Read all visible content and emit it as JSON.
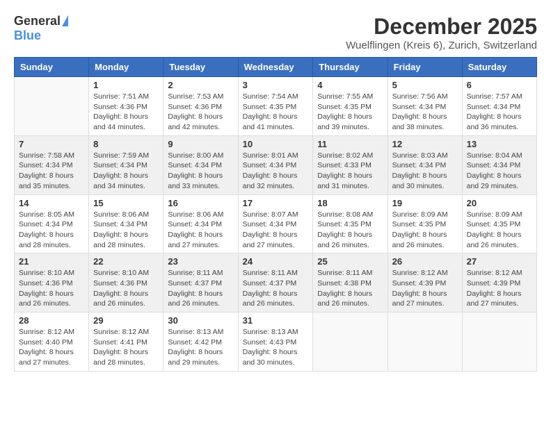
{
  "header": {
    "logo_general": "General",
    "logo_blue": "Blue",
    "title": "December 2025",
    "subtitle": "Wuelflingen (Kreis 6), Zurich, Switzerland"
  },
  "columns": [
    "Sunday",
    "Monday",
    "Tuesday",
    "Wednesday",
    "Thursday",
    "Friday",
    "Saturday"
  ],
  "weeks": [
    {
      "shaded": false,
      "days": [
        {
          "empty": true
        },
        {
          "num": "1",
          "sunrise": "7:51 AM",
          "sunset": "4:36 PM",
          "daylight": "8 hours and 44 minutes."
        },
        {
          "num": "2",
          "sunrise": "7:53 AM",
          "sunset": "4:36 PM",
          "daylight": "8 hours and 42 minutes."
        },
        {
          "num": "3",
          "sunrise": "7:54 AM",
          "sunset": "4:35 PM",
          "daylight": "8 hours and 41 minutes."
        },
        {
          "num": "4",
          "sunrise": "7:55 AM",
          "sunset": "4:35 PM",
          "daylight": "8 hours and 39 minutes."
        },
        {
          "num": "5",
          "sunrise": "7:56 AM",
          "sunset": "4:34 PM",
          "daylight": "8 hours and 38 minutes."
        },
        {
          "num": "6",
          "sunrise": "7:57 AM",
          "sunset": "4:34 PM",
          "daylight": "8 hours and 36 minutes."
        }
      ]
    },
    {
      "shaded": true,
      "days": [
        {
          "num": "7",
          "sunrise": "7:58 AM",
          "sunset": "4:34 PM",
          "daylight": "8 hours and 35 minutes."
        },
        {
          "num": "8",
          "sunrise": "7:59 AM",
          "sunset": "4:34 PM",
          "daylight": "8 hours and 34 minutes."
        },
        {
          "num": "9",
          "sunrise": "8:00 AM",
          "sunset": "4:34 PM",
          "daylight": "8 hours and 33 minutes."
        },
        {
          "num": "10",
          "sunrise": "8:01 AM",
          "sunset": "4:34 PM",
          "daylight": "8 hours and 32 minutes."
        },
        {
          "num": "11",
          "sunrise": "8:02 AM",
          "sunset": "4:33 PM",
          "daylight": "8 hours and 31 minutes."
        },
        {
          "num": "12",
          "sunrise": "8:03 AM",
          "sunset": "4:34 PM",
          "daylight": "8 hours and 30 minutes."
        },
        {
          "num": "13",
          "sunrise": "8:04 AM",
          "sunset": "4:34 PM",
          "daylight": "8 hours and 29 minutes."
        }
      ]
    },
    {
      "shaded": false,
      "days": [
        {
          "num": "14",
          "sunrise": "8:05 AM",
          "sunset": "4:34 PM",
          "daylight": "8 hours and 28 minutes."
        },
        {
          "num": "15",
          "sunrise": "8:06 AM",
          "sunset": "4:34 PM",
          "daylight": "8 hours and 28 minutes."
        },
        {
          "num": "16",
          "sunrise": "8:06 AM",
          "sunset": "4:34 PM",
          "daylight": "8 hours and 27 minutes."
        },
        {
          "num": "17",
          "sunrise": "8:07 AM",
          "sunset": "4:34 PM",
          "daylight": "8 hours and 27 minutes."
        },
        {
          "num": "18",
          "sunrise": "8:08 AM",
          "sunset": "4:35 PM",
          "daylight": "8 hours and 26 minutes."
        },
        {
          "num": "19",
          "sunrise": "8:09 AM",
          "sunset": "4:35 PM",
          "daylight": "8 hours and 26 minutes."
        },
        {
          "num": "20",
          "sunrise": "8:09 AM",
          "sunset": "4:35 PM",
          "daylight": "8 hours and 26 minutes."
        }
      ]
    },
    {
      "shaded": true,
      "days": [
        {
          "num": "21",
          "sunrise": "8:10 AM",
          "sunset": "4:36 PM",
          "daylight": "8 hours and 26 minutes."
        },
        {
          "num": "22",
          "sunrise": "8:10 AM",
          "sunset": "4:36 PM",
          "daylight": "8 hours and 26 minutes."
        },
        {
          "num": "23",
          "sunrise": "8:11 AM",
          "sunset": "4:37 PM",
          "daylight": "8 hours and 26 minutes."
        },
        {
          "num": "24",
          "sunrise": "8:11 AM",
          "sunset": "4:37 PM",
          "daylight": "8 hours and 26 minutes."
        },
        {
          "num": "25",
          "sunrise": "8:11 AM",
          "sunset": "4:38 PM",
          "daylight": "8 hours and 26 minutes."
        },
        {
          "num": "26",
          "sunrise": "8:12 AM",
          "sunset": "4:39 PM",
          "daylight": "8 hours and 27 minutes."
        },
        {
          "num": "27",
          "sunrise": "8:12 AM",
          "sunset": "4:39 PM",
          "daylight": "8 hours and 27 minutes."
        }
      ]
    },
    {
      "shaded": false,
      "days": [
        {
          "num": "28",
          "sunrise": "8:12 AM",
          "sunset": "4:40 PM",
          "daylight": "8 hours and 27 minutes."
        },
        {
          "num": "29",
          "sunrise": "8:12 AM",
          "sunset": "4:41 PM",
          "daylight": "8 hours and 28 minutes."
        },
        {
          "num": "30",
          "sunrise": "8:13 AM",
          "sunset": "4:42 PM",
          "daylight": "8 hours and 29 minutes."
        },
        {
          "num": "31",
          "sunrise": "8:13 AM",
          "sunset": "4:43 PM",
          "daylight": "8 hours and 30 minutes."
        },
        {
          "empty": true
        },
        {
          "empty": true
        },
        {
          "empty": true
        }
      ]
    }
  ]
}
